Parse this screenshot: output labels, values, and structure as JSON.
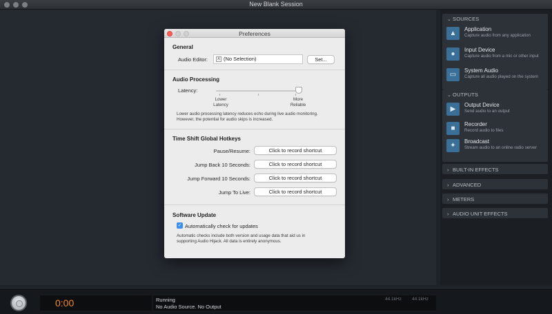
{
  "window": {
    "title": "New Blank Session"
  },
  "sidebar": {
    "sources": {
      "header": "SOURCES",
      "items": [
        {
          "name": "Application",
          "desc": "Capture audio from any application",
          "icon": "app-store-icon"
        },
        {
          "name": "Input Device",
          "desc": "Capture audio from a mic or other input",
          "icon": "microphone-icon"
        },
        {
          "name": "System Audio",
          "desc": "Capture all audio played on the system",
          "icon": "monitor-icon"
        }
      ]
    },
    "outputs": {
      "header": "OUTPUTS",
      "items": [
        {
          "name": "Output Device",
          "desc": "Send audio to an output",
          "icon": "speaker-icon"
        },
        {
          "name": "Recorder",
          "desc": "Record audio to files",
          "icon": "document-icon"
        },
        {
          "name": "Broadcast",
          "desc": "Stream audio to an online radio server",
          "icon": "bird-icon"
        }
      ]
    },
    "collapsed": [
      "BUILT-IN EFFECTS",
      "ADVANCED",
      "METERS",
      "AUDIO UNIT EFFECTS"
    ]
  },
  "preferences": {
    "title": "Preferences",
    "general": {
      "header": "General",
      "audio_editor_label": "Audio Editor:",
      "audio_editor_value": "(No Selection)",
      "set_button": "Set..."
    },
    "processing": {
      "header": "Audio Processing",
      "latency_label": "Latency:",
      "latency_level": 1.0,
      "lower_label_1": "Lower",
      "lower_label_2": "Latency",
      "more_label_1": "More",
      "more_label_2": "Reliable",
      "note_1": "Lower audio processing latency reduces echo during live audio monitoring.",
      "note_2": "However, the potential for audio skips is increased."
    },
    "hotkeys": {
      "header": "Time Shift Global Hotkeys",
      "rows": [
        {
          "label": "Pause/Resume:",
          "button": "Click to record shortcut"
        },
        {
          "label": "Jump Back 10 Seconds:",
          "button": "Click to record shortcut"
        },
        {
          "label": "Jump Forward 10 Seconds:",
          "button": "Click to record shortcut"
        },
        {
          "label": "Jump To Live:",
          "button": "Click to record shortcut"
        }
      ]
    },
    "update": {
      "header": "Software Update",
      "checkbox_label": "Automatically check for updates",
      "checked": true,
      "note_1": "Automatic checks include both version and usage data that aid us in",
      "note_2": "supporting Audio Hijack. All data is entirely anonymous."
    }
  },
  "bottom": {
    "time": "0:00",
    "status_1": "Running",
    "status_2": "No Audio Source. No Output",
    "rate_1": "44.1kHz",
    "rate_2": "44.1kHz"
  },
  "colors": {
    "accent": "#3a6f97",
    "timer": "#f08a2a",
    "checkbox": "#3b8ef2"
  }
}
